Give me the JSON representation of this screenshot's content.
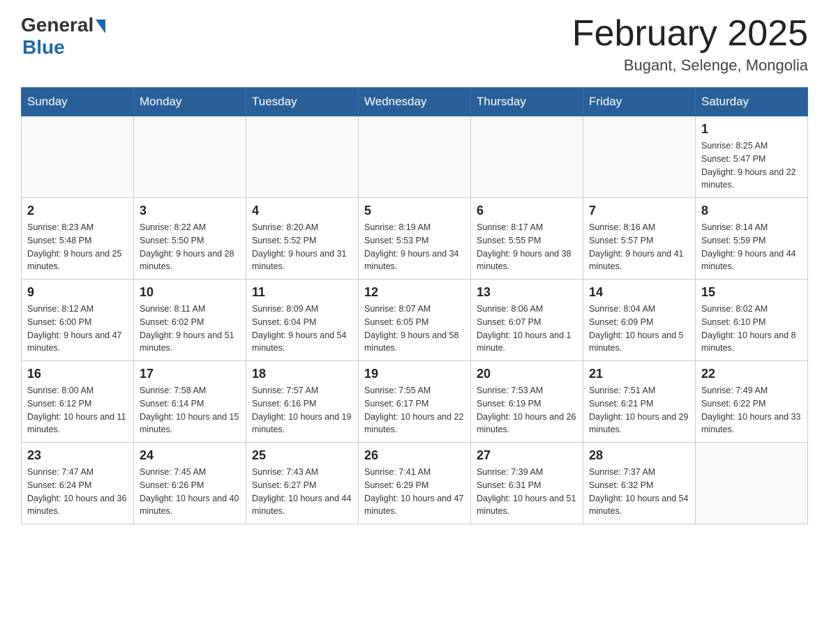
{
  "header": {
    "logo_general": "General",
    "logo_blue": "Blue",
    "month_title": "February 2025",
    "location": "Bugant, Selenge, Mongolia"
  },
  "weekdays": [
    "Sunday",
    "Monday",
    "Tuesday",
    "Wednesday",
    "Thursday",
    "Friday",
    "Saturday"
  ],
  "weeks": [
    [
      {
        "day": "",
        "info": ""
      },
      {
        "day": "",
        "info": ""
      },
      {
        "day": "",
        "info": ""
      },
      {
        "day": "",
        "info": ""
      },
      {
        "day": "",
        "info": ""
      },
      {
        "day": "",
        "info": ""
      },
      {
        "day": "1",
        "info": "Sunrise: 8:25 AM\nSunset: 5:47 PM\nDaylight: 9 hours and 22 minutes."
      }
    ],
    [
      {
        "day": "2",
        "info": "Sunrise: 8:23 AM\nSunset: 5:48 PM\nDaylight: 9 hours and 25 minutes."
      },
      {
        "day": "3",
        "info": "Sunrise: 8:22 AM\nSunset: 5:50 PM\nDaylight: 9 hours and 28 minutes."
      },
      {
        "day": "4",
        "info": "Sunrise: 8:20 AM\nSunset: 5:52 PM\nDaylight: 9 hours and 31 minutes."
      },
      {
        "day": "5",
        "info": "Sunrise: 8:19 AM\nSunset: 5:53 PM\nDaylight: 9 hours and 34 minutes."
      },
      {
        "day": "6",
        "info": "Sunrise: 8:17 AM\nSunset: 5:55 PM\nDaylight: 9 hours and 38 minutes."
      },
      {
        "day": "7",
        "info": "Sunrise: 8:16 AM\nSunset: 5:57 PM\nDaylight: 9 hours and 41 minutes."
      },
      {
        "day": "8",
        "info": "Sunrise: 8:14 AM\nSunset: 5:59 PM\nDaylight: 9 hours and 44 minutes."
      }
    ],
    [
      {
        "day": "9",
        "info": "Sunrise: 8:12 AM\nSunset: 6:00 PM\nDaylight: 9 hours and 47 minutes."
      },
      {
        "day": "10",
        "info": "Sunrise: 8:11 AM\nSunset: 6:02 PM\nDaylight: 9 hours and 51 minutes."
      },
      {
        "day": "11",
        "info": "Sunrise: 8:09 AM\nSunset: 6:04 PM\nDaylight: 9 hours and 54 minutes."
      },
      {
        "day": "12",
        "info": "Sunrise: 8:07 AM\nSunset: 6:05 PM\nDaylight: 9 hours and 58 minutes."
      },
      {
        "day": "13",
        "info": "Sunrise: 8:06 AM\nSunset: 6:07 PM\nDaylight: 10 hours and 1 minute."
      },
      {
        "day": "14",
        "info": "Sunrise: 8:04 AM\nSunset: 6:09 PM\nDaylight: 10 hours and 5 minutes."
      },
      {
        "day": "15",
        "info": "Sunrise: 8:02 AM\nSunset: 6:10 PM\nDaylight: 10 hours and 8 minutes."
      }
    ],
    [
      {
        "day": "16",
        "info": "Sunrise: 8:00 AM\nSunset: 6:12 PM\nDaylight: 10 hours and 11 minutes."
      },
      {
        "day": "17",
        "info": "Sunrise: 7:58 AM\nSunset: 6:14 PM\nDaylight: 10 hours and 15 minutes."
      },
      {
        "day": "18",
        "info": "Sunrise: 7:57 AM\nSunset: 6:16 PM\nDaylight: 10 hours and 19 minutes."
      },
      {
        "day": "19",
        "info": "Sunrise: 7:55 AM\nSunset: 6:17 PM\nDaylight: 10 hours and 22 minutes."
      },
      {
        "day": "20",
        "info": "Sunrise: 7:53 AM\nSunset: 6:19 PM\nDaylight: 10 hours and 26 minutes."
      },
      {
        "day": "21",
        "info": "Sunrise: 7:51 AM\nSunset: 6:21 PM\nDaylight: 10 hours and 29 minutes."
      },
      {
        "day": "22",
        "info": "Sunrise: 7:49 AM\nSunset: 6:22 PM\nDaylight: 10 hours and 33 minutes."
      }
    ],
    [
      {
        "day": "23",
        "info": "Sunrise: 7:47 AM\nSunset: 6:24 PM\nDaylight: 10 hours and 36 minutes."
      },
      {
        "day": "24",
        "info": "Sunrise: 7:45 AM\nSunset: 6:26 PM\nDaylight: 10 hours and 40 minutes."
      },
      {
        "day": "25",
        "info": "Sunrise: 7:43 AM\nSunset: 6:27 PM\nDaylight: 10 hours and 44 minutes."
      },
      {
        "day": "26",
        "info": "Sunrise: 7:41 AM\nSunset: 6:29 PM\nDaylight: 10 hours and 47 minutes."
      },
      {
        "day": "27",
        "info": "Sunrise: 7:39 AM\nSunset: 6:31 PM\nDaylight: 10 hours and 51 minutes."
      },
      {
        "day": "28",
        "info": "Sunrise: 7:37 AM\nSunset: 6:32 PM\nDaylight: 10 hours and 54 minutes."
      },
      {
        "day": "",
        "info": ""
      }
    ]
  ]
}
